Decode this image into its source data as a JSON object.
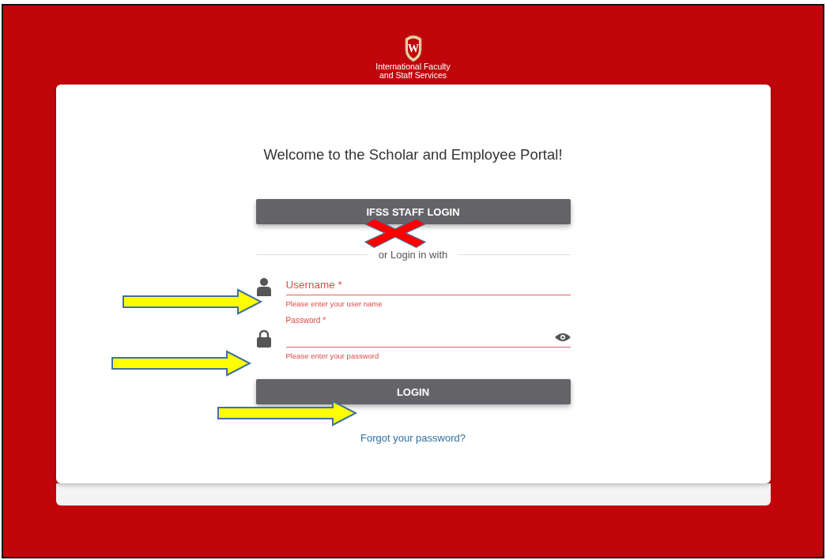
{
  "logo": {
    "letter": "W",
    "lines": [
      "International Faculty",
      "and Staff Services"
    ]
  },
  "title": "Welcome to the Scholar and Employee Portal!",
  "staff_login_button": "IFSS STAFF LOGIN",
  "divider_text": "or Login in with",
  "fields": [
    {
      "kind": "text",
      "label": "Username *",
      "error": "Please enter your user name",
      "floated": false
    },
    {
      "kind": "password",
      "label": "Password *",
      "error": "Please enter your password",
      "floated": true
    }
  ],
  "login_button": "LOGIN",
  "forgot_link": "Forgot your password?",
  "annotations": [
    {
      "kind": "arrow"
    },
    {
      "kind": "arrow"
    },
    {
      "kind": "arrow"
    },
    {
      "kind": "cross"
    }
  ]
}
